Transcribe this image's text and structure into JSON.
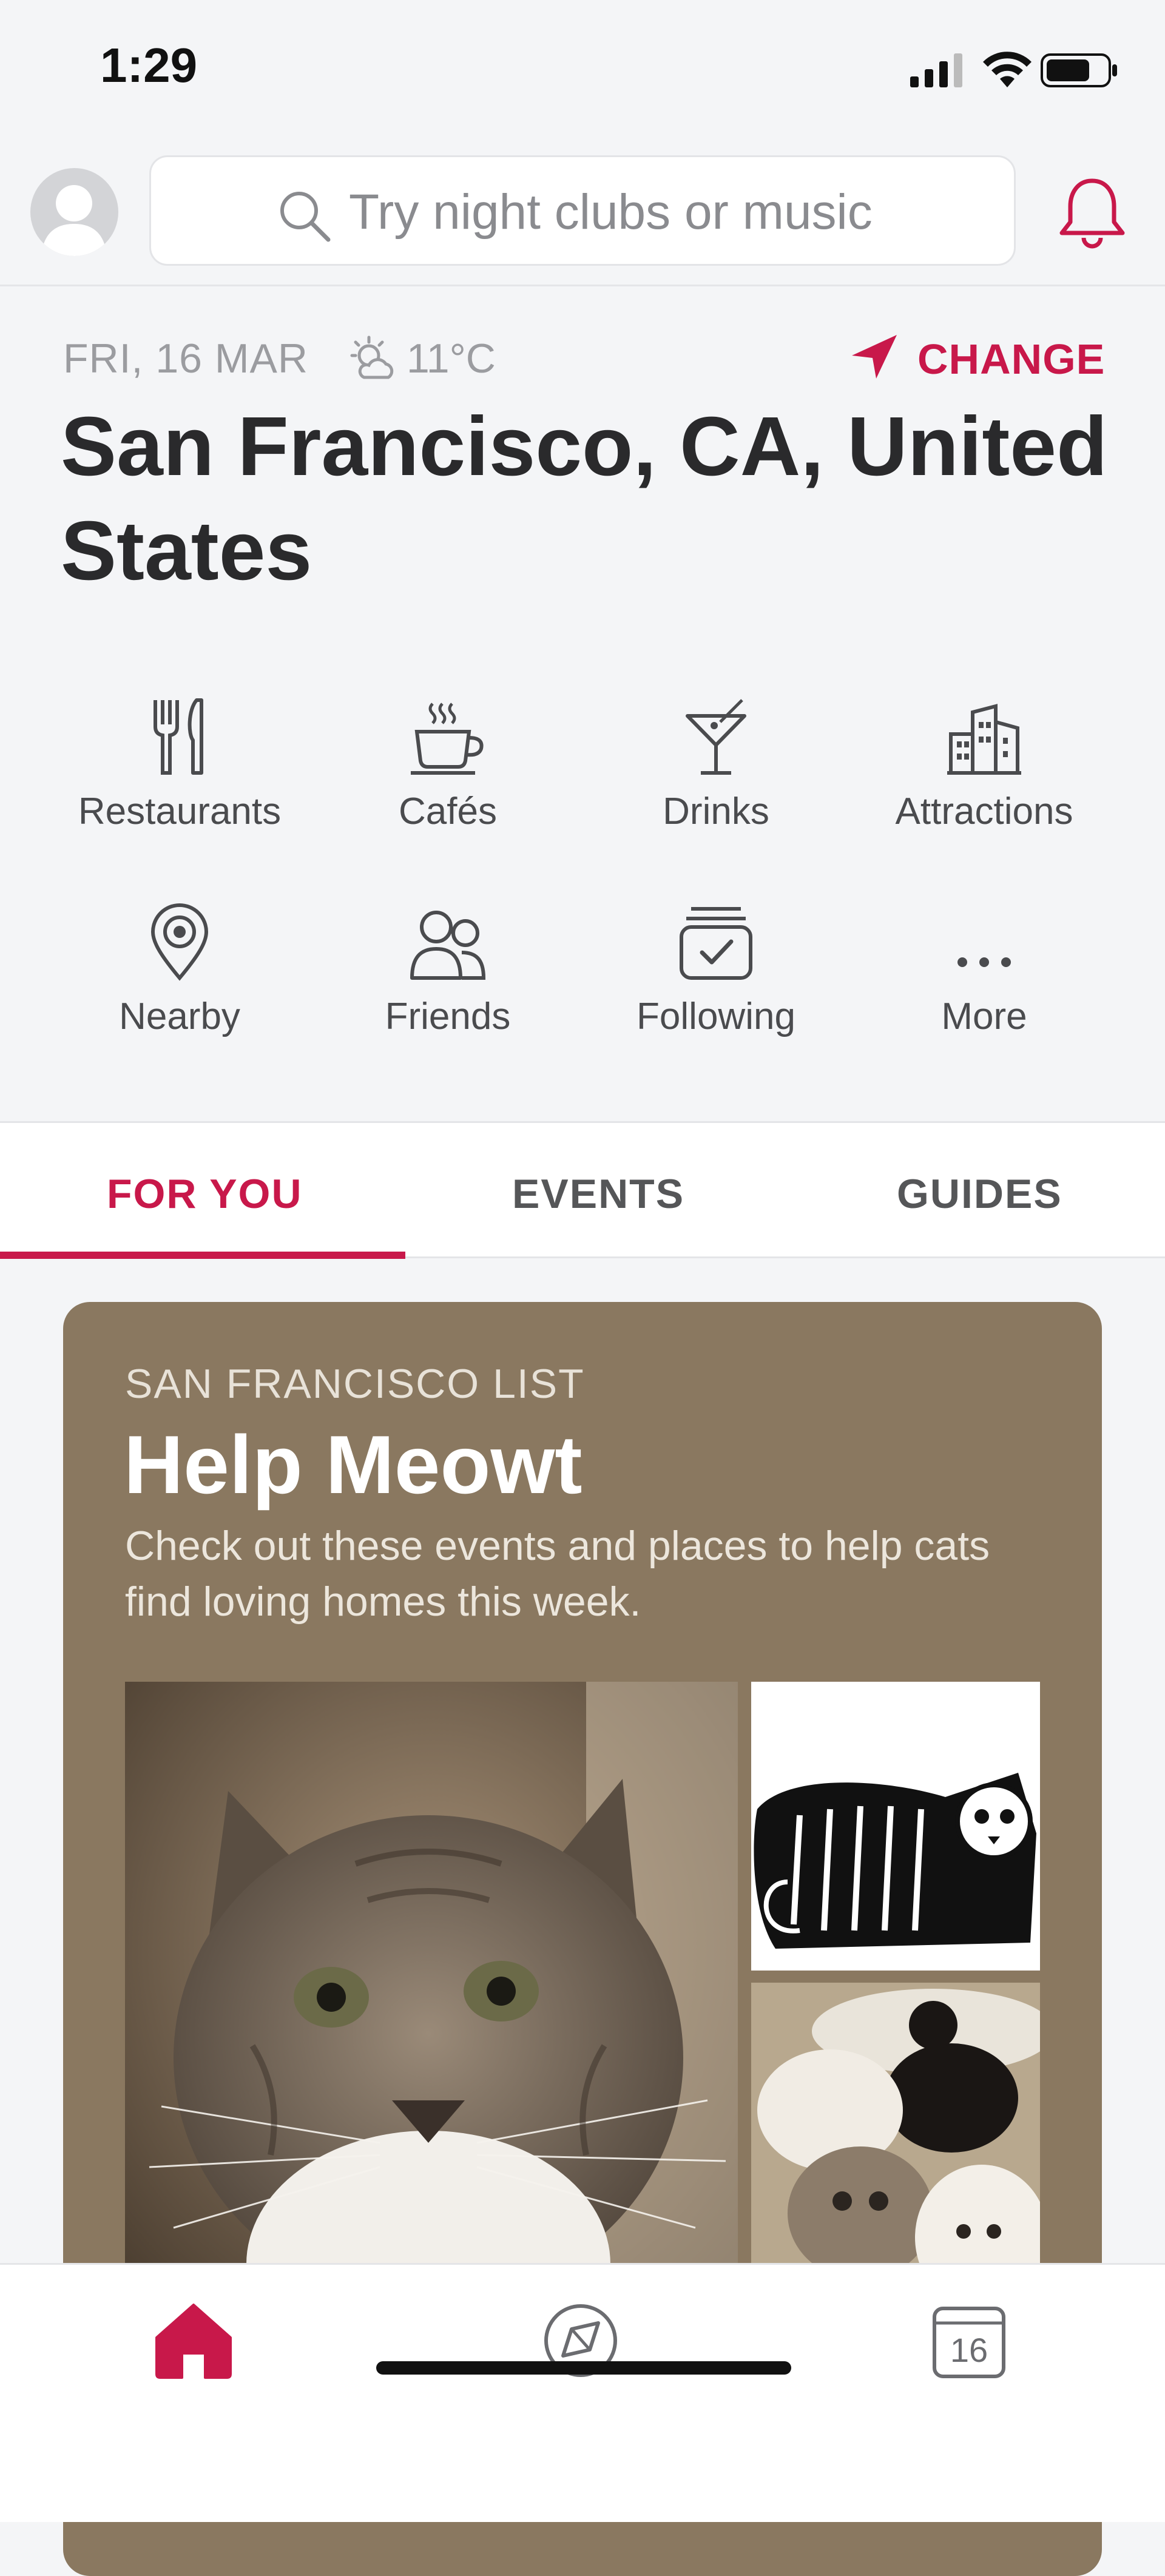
{
  "status_bar": {
    "time": "1:29"
  },
  "search": {
    "placeholder": "Try night clubs or music"
  },
  "header": {
    "date": "FRI, 16 MAR",
    "temperature": "11°C",
    "change_label": "CHANGE",
    "location": "San Francisco, CA, United States"
  },
  "categories": [
    {
      "label": "Restaurants",
      "icon": "fork-knife-icon"
    },
    {
      "label": "Cafés",
      "icon": "coffee-cup-icon"
    },
    {
      "label": "Drinks",
      "icon": "cocktail-icon"
    },
    {
      "label": "Attractions",
      "icon": "buildings-icon"
    },
    {
      "label": "Nearby",
      "icon": "location-pin-icon"
    },
    {
      "label": "Friends",
      "icon": "friends-icon"
    },
    {
      "label": "Following",
      "icon": "following-jar-icon"
    },
    {
      "label": "More",
      "icon": "more-dots-icon"
    }
  ],
  "tabs": [
    {
      "label": "FOR YOU",
      "active": true
    },
    {
      "label": "EVENTS",
      "active": false
    },
    {
      "label": "GUIDES",
      "active": false
    }
  ],
  "card": {
    "kicker": "SAN FRANCISCO LIST",
    "title": "Help Meowt",
    "description": "Check out these events and places to help cats find loving homes this week."
  },
  "bottom_nav": {
    "items": [
      {
        "icon": "home-icon",
        "active": true
      },
      {
        "icon": "compass-icon",
        "active": false
      },
      {
        "icon": "calendar-icon",
        "label": "16",
        "active": false
      }
    ]
  },
  "colors": {
    "accent": "#c8184a",
    "card_bg": "#8a7860",
    "page_bg": "#f4f5f7"
  }
}
